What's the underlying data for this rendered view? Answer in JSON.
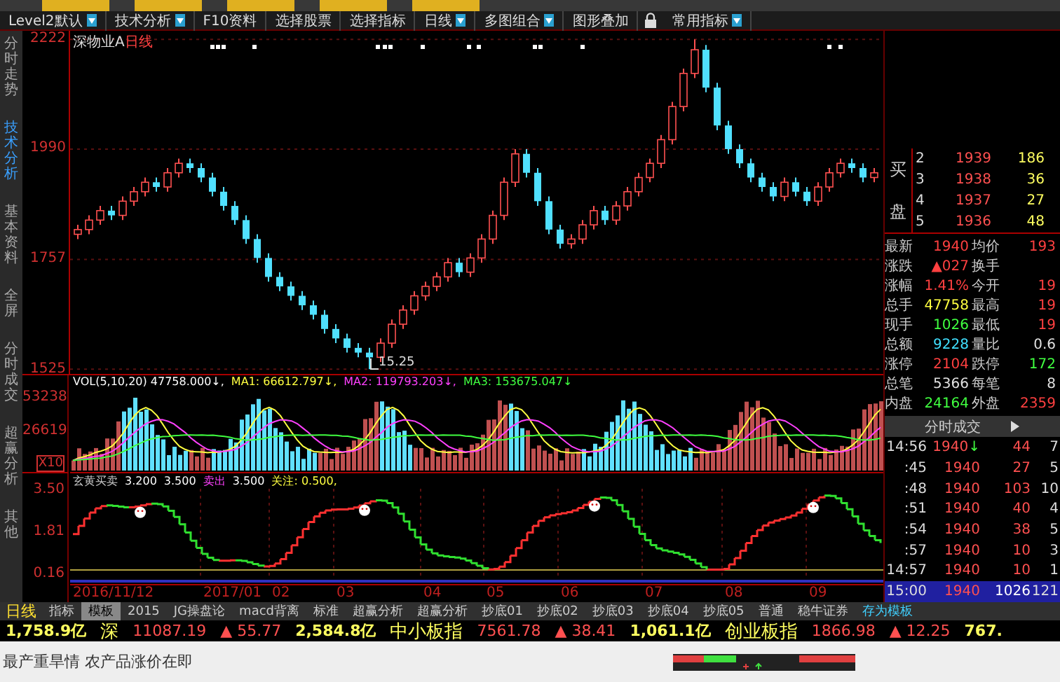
{
  "top_tabs": [
    {
      "selected": false
    },
    {
      "selected": false
    },
    {
      "selected": false
    },
    {
      "selected": false
    },
    {
      "selected": false
    }
  ],
  "menu": [
    {
      "kind": "dropdown",
      "label": "Level2默认"
    },
    {
      "kind": "dropdown",
      "label": "技术分析"
    },
    {
      "kind": "button",
      "label": "F10资料"
    },
    {
      "kind": "button",
      "label": "选择股票"
    },
    {
      "kind": "button",
      "label": "选择指标"
    },
    {
      "kind": "dropdown",
      "label": "日线"
    },
    {
      "kind": "dropdown",
      "label": "多图组合"
    },
    {
      "kind": "button",
      "label": "图形叠加"
    },
    {
      "kind": "lock"
    },
    {
      "kind": "dropdown",
      "label": "常用指标"
    }
  ],
  "sidebar": {
    "items": [
      {
        "label": "分时走势",
        "selected": false
      },
      {
        "label": "技术分析",
        "selected": true
      },
      {
        "label": "基本资料",
        "selected": false
      },
      {
        "label": "全屏",
        "selected": false
      },
      {
        "label": "分时成交",
        "selected": false
      },
      {
        "label": "超赢分析",
        "selected": false
      },
      {
        "label": "其他",
        "selected": false
      }
    ]
  },
  "main_chart": {
    "stock": "深物业A",
    "period": "日线",
    "low_marker": "15.25",
    "chart_data": {
      "type": "candlestick",
      "ylim": [
        1515,
        2240
      ],
      "yticks": [
        1525,
        1757,
        1990,
        2222
      ],
      "grid": true,
      "ohlc": [
        [
          1810,
          1830,
          1800,
          1820
        ],
        [
          1820,
          1850,
          1810,
          1840
        ],
        [
          1840,
          1870,
          1830,
          1860
        ],
        [
          1860,
          1870,
          1840,
          1850
        ],
        [
          1850,
          1890,
          1840,
          1880
        ],
        [
          1880,
          1910,
          1870,
          1900
        ],
        [
          1900,
          1930,
          1890,
          1920
        ],
        [
          1920,
          1930,
          1900,
          1910
        ],
        [
          1910,
          1950,
          1900,
          1940
        ],
        [
          1940,
          1970,
          1930,
          1960
        ],
        [
          1960,
          1970,
          1940,
          1950
        ],
        [
          1950,
          1960,
          1920,
          1930
        ],
        [
          1930,
          1940,
          1890,
          1900
        ],
        [
          1900,
          1910,
          1860,
          1870
        ],
        [
          1870,
          1880,
          1830,
          1840
        ],
        [
          1840,
          1850,
          1790,
          1800
        ],
        [
          1800,
          1810,
          1750,
          1760
        ],
        [
          1760,
          1770,
          1710,
          1720
        ],
        [
          1720,
          1730,
          1690,
          1700
        ],
        [
          1700,
          1710,
          1670,
          1680
        ],
        [
          1680,
          1690,
          1650,
          1660
        ],
        [
          1660,
          1670,
          1630,
          1640
        ],
        [
          1640,
          1650,
          1600,
          1610
        ],
        [
          1610,
          1620,
          1580,
          1590
        ],
        [
          1590,
          1600,
          1560,
          1570
        ],
        [
          1570,
          1580,
          1550,
          1560
        ],
        [
          1560,
          1570,
          1525,
          1550
        ],
        [
          1550,
          1590,
          1540,
          1580
        ],
        [
          1580,
          1630,
          1570,
          1620
        ],
        [
          1620,
          1660,
          1610,
          1650
        ],
        [
          1650,
          1690,
          1640,
          1680
        ],
        [
          1680,
          1710,
          1670,
          1700
        ],
        [
          1700,
          1730,
          1690,
          1720
        ],
        [
          1720,
          1760,
          1710,
          1750
        ],
        [
          1750,
          1760,
          1720,
          1730
        ],
        [
          1730,
          1770,
          1720,
          1760
        ],
        [
          1760,
          1810,
          1750,
          1800
        ],
        [
          1800,
          1860,
          1790,
          1850
        ],
        [
          1850,
          1930,
          1840,
          1920
        ],
        [
          1920,
          1990,
          1910,
          1980
        ],
        [
          1980,
          1990,
          1930,
          1940
        ],
        [
          1940,
          1950,
          1870,
          1880
        ],
        [
          1880,
          1890,
          1810,
          1820
        ],
        [
          1820,
          1830,
          1780,
          1790
        ],
        [
          1790,
          1810,
          1780,
          1800
        ],
        [
          1800,
          1840,
          1790,
          1830
        ],
        [
          1830,
          1870,
          1820,
          1860
        ],
        [
          1860,
          1870,
          1830,
          1840
        ],
        [
          1840,
          1880,
          1830,
          1870
        ],
        [
          1870,
          1910,
          1860,
          1900
        ],
        [
          1900,
          1940,
          1890,
          1930
        ],
        [
          1930,
          1970,
          1920,
          1960
        ],
        [
          1960,
          2020,
          1950,
          2010
        ],
        [
          2010,
          2090,
          2000,
          2080
        ],
        [
          2080,
          2160,
          2070,
          2150
        ],
        [
          2150,
          2222,
          2140,
          2200
        ],
        [
          2200,
          2210,
          2110,
          2120
        ],
        [
          2120,
          2130,
          2030,
          2040
        ],
        [
          2040,
          2050,
          1980,
          1990
        ],
        [
          1990,
          2000,
          1950,
          1960
        ],
        [
          1960,
          1970,
          1920,
          1930
        ],
        [
          1930,
          1940,
          1900,
          1910
        ],
        [
          1910,
          1920,
          1880,
          1890
        ],
        [
          1890,
          1930,
          1880,
          1920
        ],
        [
          1920,
          1930,
          1890,
          1900
        ],
        [
          1900,
          1910,
          1870,
          1880
        ],
        [
          1880,
          1920,
          1870,
          1910
        ],
        [
          1910,
          1950,
          1900,
          1940
        ],
        [
          1940,
          1970,
          1930,
          1960
        ],
        [
          1960,
          1970,
          1940,
          1950
        ],
        [
          1950,
          1960,
          1920,
          1930
        ],
        [
          1930,
          1950,
          1920,
          1940
        ]
      ]
    }
  },
  "volume_panel": {
    "ticks": [
      "53238",
      "26619"
    ],
    "unit": "X10",
    "legend": [
      {
        "text": "VOL(5,10,20) 47758.000↓,",
        "color": "#ffffff"
      },
      {
        "text": "MA1: 66612.797↓,",
        "color": "#ffff40"
      },
      {
        "text": "MA2: 119793.203↓,",
        "color": "#ff40ff"
      },
      {
        "text": "MA3: 153675.047↓",
        "color": "#40ff40"
      }
    ]
  },
  "indicator_panel": {
    "ticks": [
      "3.50",
      "1.81",
      "0.16"
    ],
    "legend": [
      {
        "text": "玄黄买卖",
        "color": "#c8c8c8"
      },
      {
        "text": "3.200",
        "color": "#ffffff"
      },
      {
        "text": "3.500",
        "color": "#ffffff"
      },
      {
        "text": "卖出",
        "color": "#ff40ff"
      },
      {
        "text": "3.500",
        "color": "#ffffff"
      },
      {
        "text": "关注: 0.500,",
        "color": "#ffff40"
      }
    ]
  },
  "date_axis": {
    "period": "日线",
    "labels": [
      "2016/11/12",
      "2017/01",
      "02",
      "03",
      "04",
      "05",
      "06",
      "07",
      "08",
      "09"
    ]
  },
  "template_tabs": [
    {
      "kind": "tab",
      "label": "指标",
      "selected": false
    },
    {
      "kind": "tab",
      "label": "模板",
      "selected": true
    },
    {
      "kind": "tab",
      "label": "2015",
      "selected": false
    },
    {
      "kind": "tab",
      "label": "JG操盘论",
      "selected": false
    },
    {
      "kind": "tab",
      "label": "macd背离",
      "selected": false
    },
    {
      "kind": "tab",
      "label": "标准",
      "selected": false
    },
    {
      "kind": "tab",
      "label": "超赢分析",
      "selected": false
    },
    {
      "kind": "tab",
      "label": "超赢分析",
      "selected": false
    },
    {
      "kind": "tab",
      "label": "抄底01",
      "selected": false
    },
    {
      "kind": "tab",
      "label": "抄底02",
      "selected": false
    },
    {
      "kind": "tab",
      "label": "抄底03",
      "selected": false
    },
    {
      "kind": "tab",
      "label": "抄底04",
      "selected": false
    },
    {
      "kind": "tab",
      "label": "抄底05",
      "selected": false
    },
    {
      "kind": "tab",
      "label": "普通",
      "selected": false
    },
    {
      "kind": "tab",
      "label": "稳牛证券",
      "selected": false
    },
    {
      "kind": "action",
      "label": "存为模板",
      "selected": false
    }
  ],
  "indices": [
    {
      "amount": "1,758.9亿",
      "name": "深",
      "value": "11087.19",
      "change": "▲ 55.77"
    },
    {
      "amount": "2,584.8亿",
      "name": "中小板指",
      "value": "7561.78",
      "change": "▲ 38.41"
    },
    {
      "amount": "1,061.1亿",
      "name": "创业板指",
      "value": "1866.98",
      "change": "▲ 12.25"
    },
    {
      "amount": "767."
    }
  ],
  "ticker": "最产重旱情 农产品涨价在即",
  "order_book": {
    "side": "买",
    "side2": "盘",
    "rows": [
      {
        "level": "2",
        "price": "1939",
        "volume": "186"
      },
      {
        "level": "3",
        "price": "1938",
        "volume": "36"
      },
      {
        "level": "4",
        "price": "1937",
        "volume": "27"
      },
      {
        "level": "5",
        "price": "1936",
        "volume": "48"
      }
    ]
  },
  "quote": [
    {
      "cells": [
        {
          "label": "最新",
          "value": "1940",
          "color": "#ff4040"
        },
        {
          "label": "均价",
          "value": "193",
          "color": "#ff4040"
        }
      ]
    },
    {
      "cells": [
        {
          "label": "涨跌",
          "value": "▲027",
          "color": "#ff4040"
        },
        {
          "label": "换手"
        }
      ]
    },
    {
      "cells": [
        {
          "label": "涨幅",
          "value": "1.41%",
          "color": "#ff4040"
        },
        {
          "label": "今开",
          "value": "19",
          "color": "#ff4040"
        }
      ]
    },
    {
      "cells": [
        {
          "label": "总手",
          "value": "47758",
          "color": "#ffff40"
        },
        {
          "label": "最高",
          "value": "19",
          "color": "#ff4040"
        }
      ]
    },
    {
      "cells": [
        {
          "label": "现手",
          "value": "1026",
          "color": "#40ff40"
        },
        {
          "label": "最低",
          "value": "19",
          "color": "#ff4040"
        }
      ]
    },
    {
      "cells": [
        {
          "label": "总额",
          "value": "9228",
          "color": "#40e0ff"
        },
        {
          "label": "量比",
          "value": "0.6",
          "color": "#e0e0e0"
        }
      ]
    },
    {
      "cells": [
        {
          "label": "涨停",
          "value": "2104",
          "color": "#ff4040"
        },
        {
          "label": "跌停",
          "value": "172",
          "color": "#40ff40"
        }
      ]
    },
    {
      "cells": [
        {
          "label": "总笔",
          "value": "5366",
          "color": "#e0e0e0"
        },
        {
          "label": "每笔",
          "value": "8",
          "color": "#e0e0e0"
        }
      ]
    },
    {
      "cells": [
        {
          "label": "内盘",
          "value": "24164",
          "color": "#40ff40"
        },
        {
          "label": "外盘",
          "value": "2359",
          "color": "#ff4040"
        }
      ]
    }
  ],
  "trades": {
    "title": "分时成交",
    "rows": [
      {
        "time": "14:56",
        "price": "1940",
        "arrow": "↓",
        "volume": "44",
        "count": "7",
        "selected": false
      },
      {
        "time": ":45",
        "price": "1940",
        "volume": "27",
        "count": "5",
        "selected": false
      },
      {
        "time": ":48",
        "price": "1940",
        "volume": "103",
        "count": "10",
        "selected": false
      },
      {
        "time": ":51",
        "price": "1940",
        "volume": "40",
        "count": "4",
        "selected": false
      },
      {
        "time": ":54",
        "price": "1940",
        "volume": "38",
        "count": "5",
        "selected": false
      },
      {
        "time": ":57",
        "price": "1940",
        "volume": "10",
        "count": "3",
        "selected": false
      },
      {
        "time": "14:57",
        "price": "1940",
        "volume": "10",
        "count": "1",
        "selected": false
      },
      {
        "time": "15:00",
        "price": "1940",
        "volume": "1026",
        "count": "121",
        "selected": true
      }
    ]
  }
}
